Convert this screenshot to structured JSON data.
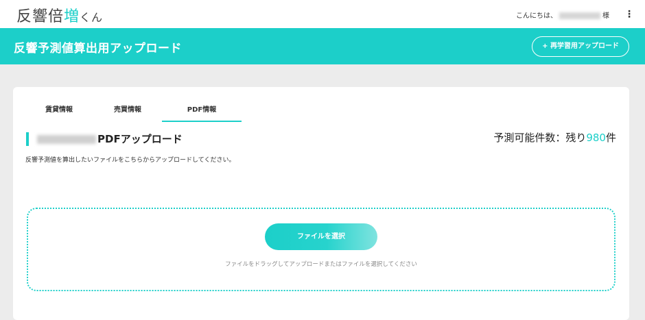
{
  "header": {
    "logo_main": "反響倍",
    "logo_accent": "増",
    "logo_suffix": "くん",
    "greeting_prefix": "こんにちは、",
    "greeting_suffix": "様",
    "menu_icon": "kebab-icon"
  },
  "banner": {
    "title": "反響予測値算出用アップロード",
    "relearn_label": "+ 再学習用アップロード"
  },
  "tabs": [
    {
      "label": "賃貸情報",
      "active": false
    },
    {
      "label": "売買情報",
      "active": false
    },
    {
      "label": "PDF情報",
      "active": true
    }
  ],
  "section": {
    "heading": "PDFアップロード",
    "remaining_prefix": "予測可能件数：残り",
    "remaining_count": "980",
    "remaining_suffix": "件",
    "description": "反響予測値を算出したいファイルをこちらからアップロードしてください。"
  },
  "dropzone": {
    "select_label": "ファイルを選択",
    "hint": "ファイルをドラッグしてアップロードまたはファイルを選択してください"
  },
  "colors": {
    "accent": "#1ccfc9",
    "background": "#ececec"
  }
}
